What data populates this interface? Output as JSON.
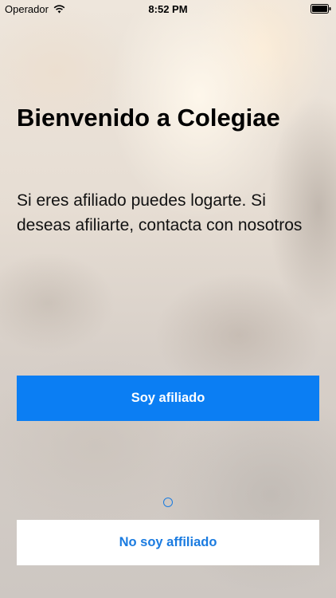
{
  "status_bar": {
    "carrier": "Operador",
    "time": "8:52 PM",
    "signal_icon": "wifi-icon",
    "battery_icon": "battery-icon"
  },
  "welcome": {
    "title": "Bienvenido a Colegiae",
    "message": "Si eres afiliado puedes logarte. Si deseas afiliarte, contacta con nosotros"
  },
  "actions": {
    "affiliate_label": "Soy afiliado",
    "not_affiliate_label": "No soy affiliado"
  },
  "colors": {
    "primary_button": "#0b7ef3",
    "secondary_button_text": "#1a7be0",
    "secondary_button_bg": "#ffffff"
  }
}
